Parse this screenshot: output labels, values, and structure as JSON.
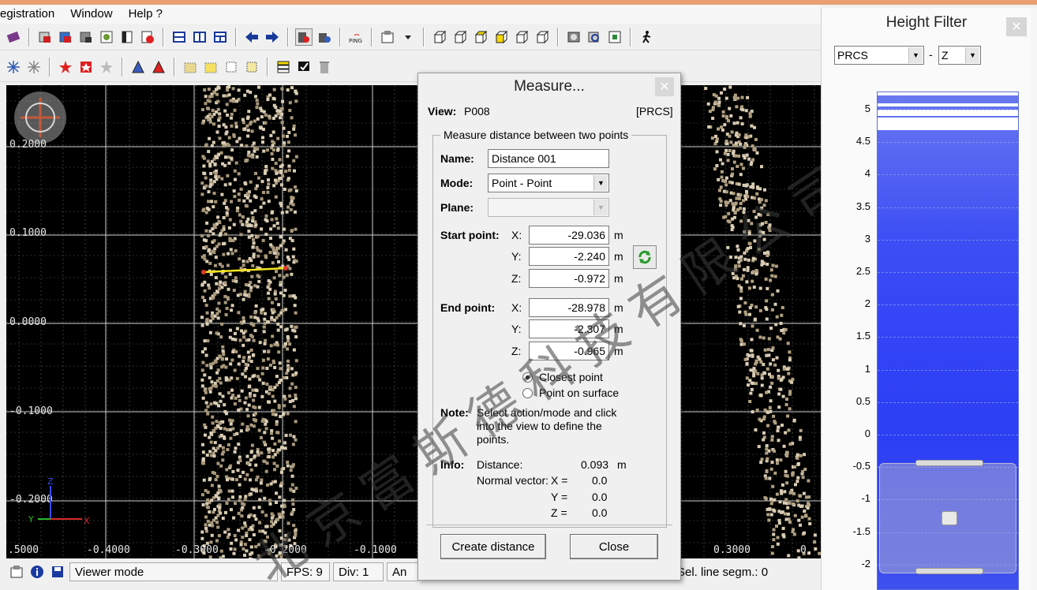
{
  "menubar": {
    "items": [
      "egistration",
      "Window",
      "Help ?"
    ]
  },
  "viewer": {
    "y_ticks": [
      "0.2000",
      "0.1000",
      "0.0000",
      "-0.1000",
      "-0.2000"
    ],
    "x_ticks": [
      ".5000",
      "-0.4000",
      "-0.3000",
      "-0.2000",
      "-0.1000",
      "0.3000",
      "0."
    ]
  },
  "statusbar": {
    "mode": "Viewer mode",
    "fps": "FPS: 9",
    "div": "Div: 1",
    "an": "An",
    "sel": "Sel. line segm.: 0"
  },
  "measure": {
    "title": "Measure...",
    "view_label": "View:",
    "view_value": "P008",
    "coord_system": "[PRCS]",
    "group_legend": "Measure distance between two points",
    "name_label": "Name:",
    "name_value": "Distance 001",
    "mode_label": "Mode:",
    "mode_value": "Point - Point",
    "plane_label": "Plane:",
    "plane_value": "",
    "start_label": "Start point:",
    "end_label": "End point:",
    "x_label": "X:",
    "y_label": "Y:",
    "z_label": "Z:",
    "unit": "m",
    "start": {
      "x": "-29.036",
      "y": "-2.240",
      "z": "-0.972"
    },
    "end": {
      "x": "-28.978",
      "y": "-2.307",
      "z": "-0.965"
    },
    "radio_closest": "Closest point",
    "radio_surface": "Point on surface",
    "note_label": "Note:",
    "note_line1": "Select action/mode and click",
    "note_line2": "into the view to define the",
    "note_line3": "points.",
    "info_label": "Info:",
    "distance_label": "Distance:",
    "distance_value": "0.093",
    "normal_label": "Normal vector:",
    "nx_label": "X =",
    "ny_label": "Y =",
    "nz_label": "Z =",
    "nx": "0.0",
    "ny": "0.0",
    "nz": "0.0",
    "create_button": "Create distance",
    "close_button": "Close"
  },
  "height_filter": {
    "title": "Height Filter",
    "coord_select": "PRCS",
    "separator": "-",
    "axis_select": "Z",
    "ticks": [
      "5",
      "4.5",
      "4",
      "3.5",
      "3",
      "2.5",
      "2",
      "1.5",
      "1",
      "0.5",
      "0",
      "-0.5",
      "-1",
      "-1.5",
      "-2"
    ]
  },
  "watermark": "北京富斯德科技有限公司",
  "colors": {
    "accent": "#e8a071",
    "bar": "#3244f6",
    "measure_line": "#f5e51b"
  }
}
